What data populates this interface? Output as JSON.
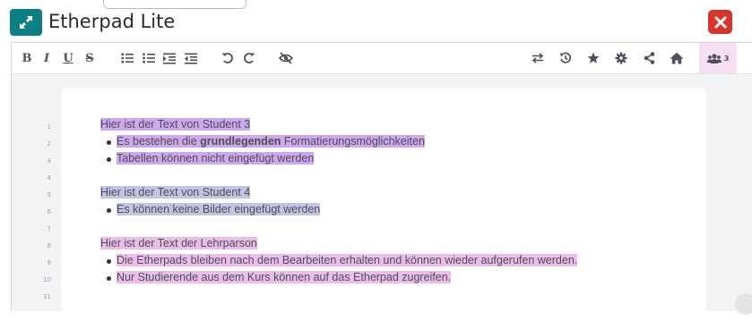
{
  "app": {
    "title": "Etherpad Lite",
    "accent_color": "#0b7f83",
    "close_color": "#d8342c",
    "user_count": "3"
  },
  "toolbar": {
    "left": [
      {
        "name": "bold",
        "glyph": "B"
      },
      {
        "name": "italic",
        "glyph": "I"
      },
      {
        "name": "underline",
        "glyph": "U"
      },
      {
        "name": "strikethrough",
        "glyph": "S"
      },
      {
        "name": "ordered-list",
        "icon": "ordered-list-icon"
      },
      {
        "name": "unordered-list",
        "icon": "unordered-list-icon"
      },
      {
        "name": "indent",
        "icon": "indent-icon"
      },
      {
        "name": "outdent",
        "icon": "outdent-icon"
      },
      {
        "name": "undo",
        "icon": "undo-icon"
      },
      {
        "name": "redo",
        "icon": "redo-icon"
      },
      {
        "name": "clear-authorship",
        "icon": "eye-slash-icon"
      }
    ],
    "right": [
      {
        "name": "import-export",
        "icon": "import-export-icon"
      },
      {
        "name": "timeslider",
        "icon": "history-icon"
      },
      {
        "name": "saved-revision",
        "icon": "star-icon"
      },
      {
        "name": "settings",
        "icon": "gear-icon"
      },
      {
        "name": "share",
        "icon": "share-icon"
      },
      {
        "name": "home",
        "icon": "home-icon"
      },
      {
        "name": "users",
        "icon": "users-icon"
      }
    ]
  },
  "pad": {
    "lines": [
      {
        "num": "1",
        "text": "Hier ist der Text von Student 3",
        "author": "s3"
      },
      {
        "num": "2",
        "pre": "Es bestehen die ",
        "bold": "grundlegenden",
        "post": " Formatierungsmöglichkeiten",
        "author": "s3"
      },
      {
        "num": "3",
        "text": "Tabellen können nicht eingefügt werden",
        "author": "s3"
      },
      {
        "num": "4",
        "text": ""
      },
      {
        "num": "5",
        "text": "Hier ist der Text von Student 4",
        "author": "s4"
      },
      {
        "num": "6",
        "text": "Es können keine Bilder eingefügt werden",
        "author": "s4"
      },
      {
        "num": "7",
        "text": ""
      },
      {
        "num": "8",
        "text": "Hier ist der Text der Lehrparson",
        "author": "lp"
      },
      {
        "num": "9",
        "text": "Die Etherpads bleiben nach dem Bearbeiten erhalten und können wieder aufgerufen werden.",
        "author": "lp"
      },
      {
        "num": "10",
        "text": "Nur Studierende aus dem Kurs können auf das Etherpad zugreifen.",
        "author": "lp"
      },
      {
        "num": "11",
        "text": ""
      }
    ],
    "author_colors": {
      "s3": "#cea7ee",
      "s4": "#c3c4e4",
      "lp": "#ecbdea"
    }
  }
}
